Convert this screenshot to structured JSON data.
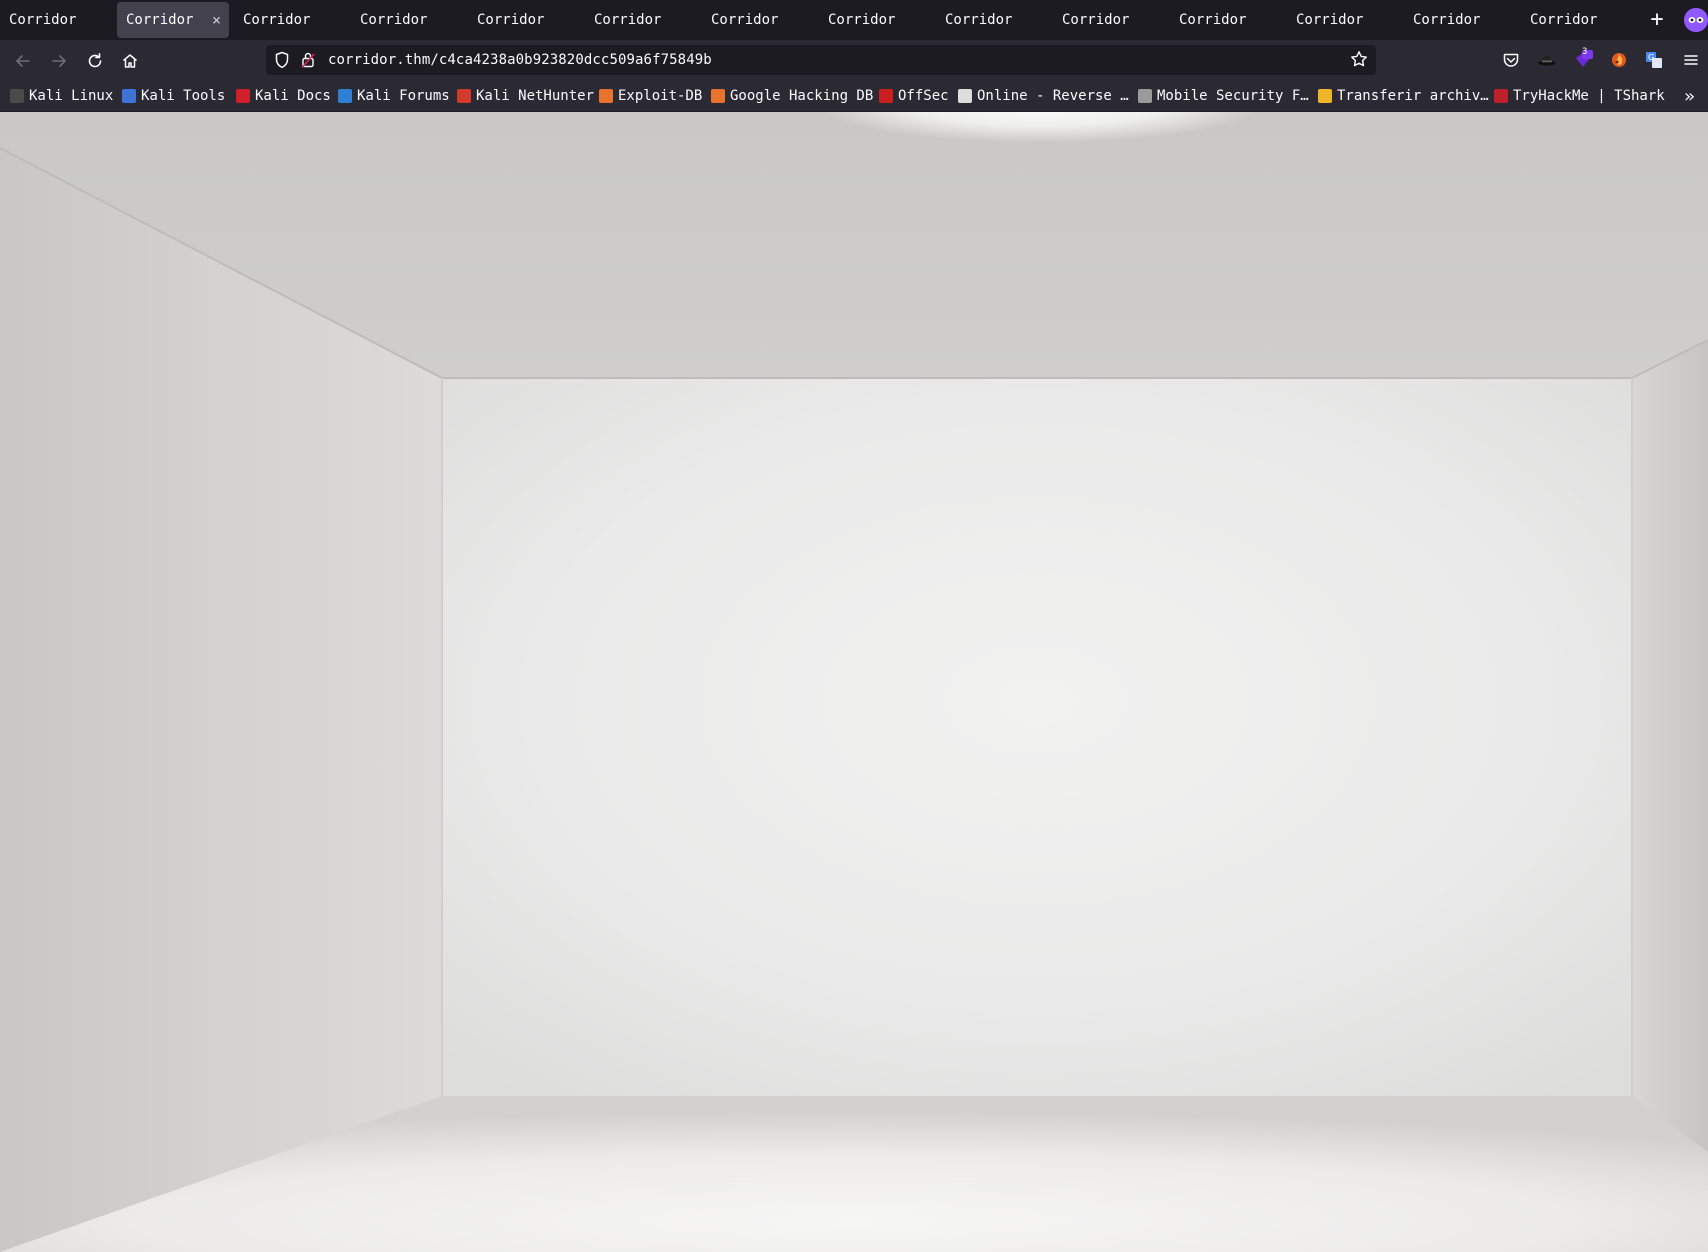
{
  "browser": {
    "tabs": [
      {
        "label": "Corridor",
        "active": false
      },
      {
        "label": "Corridor",
        "active": true
      },
      {
        "label": "Corridor",
        "active": false
      },
      {
        "label": "Corridor",
        "active": false
      },
      {
        "label": "Corridor",
        "active": false
      },
      {
        "label": "Corridor",
        "active": false
      },
      {
        "label": "Corridor",
        "active": false
      },
      {
        "label": "Corridor",
        "active": false
      },
      {
        "label": "Corridor",
        "active": false
      },
      {
        "label": "Corridor",
        "active": false
      },
      {
        "label": "Corridor",
        "active": false
      },
      {
        "label": "Corridor",
        "active": false
      },
      {
        "label": "Corridor",
        "active": false
      },
      {
        "label": "Corridor",
        "active": false
      }
    ],
    "tab_close_glyph": "×",
    "new_tab_glyph": "+",
    "url": "corridor.thm/c4ca4238a0b923820dcc509a6f75849b",
    "extension_badge_count": "3",
    "bookmarks": [
      {
        "label": "Kali Linux",
        "icon_color": "#4a4a4a"
      },
      {
        "label": "Kali Tools",
        "icon_color": "#3f73d8"
      },
      {
        "label": "Kali Docs",
        "icon_color": "#d11f2b"
      },
      {
        "label": "Kali Forums",
        "icon_color": "#2f7fd6"
      },
      {
        "label": "Kali NetHunter",
        "icon_color": "#d33a2c"
      },
      {
        "label": "Exploit-DB",
        "icon_color": "#e8732d"
      },
      {
        "label": "Google Hacking DB",
        "icon_color": "#e8732d"
      },
      {
        "label": "OffSec",
        "icon_color": "#c9201f"
      },
      {
        "label": "Online - Reverse …",
        "icon_color": "#dddddd"
      },
      {
        "label": "Mobile Security F…",
        "icon_color": "#9a9a9a"
      },
      {
        "label": "Transferir archiv…",
        "icon_color": "#f0b429"
      },
      {
        "label": "TryHackMe | TShark",
        "icon_color": "#c11f2b"
      }
    ],
    "bookmarks_overflow_glyph": "»"
  },
  "colors": {
    "tabstrip_bg": "#1c1b22",
    "toolbar_bg": "#2b2a33",
    "active_tab_bg": "#42414d",
    "profile_accent": "#9059ff"
  },
  "room": {
    "description": "empty white room rendered in perspective (ceiling, floor, left/right/back walls)"
  }
}
